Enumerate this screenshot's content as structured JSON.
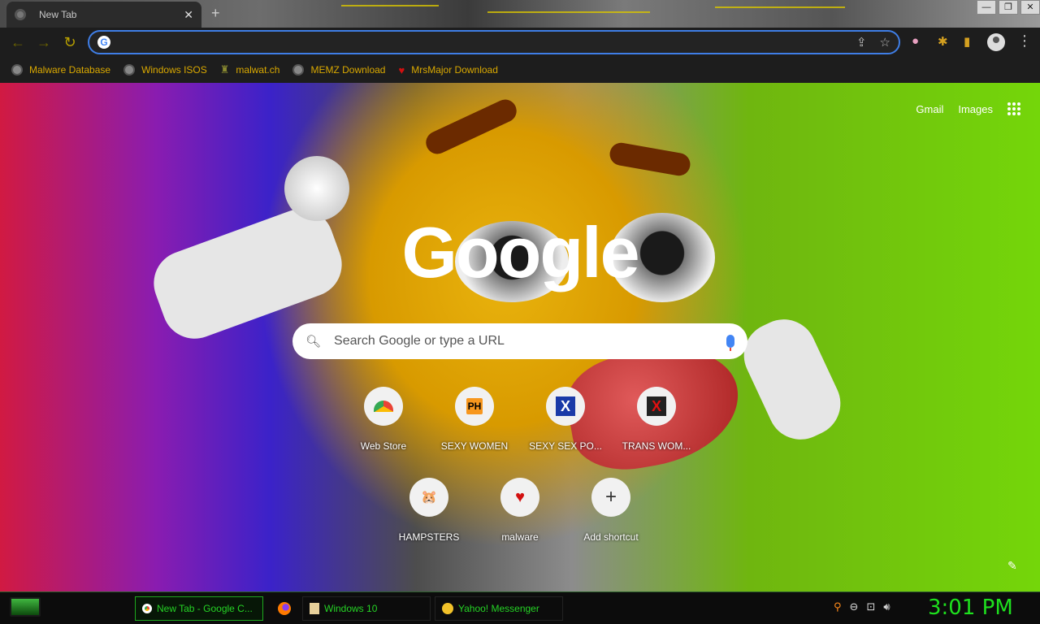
{
  "browser": {
    "tab": {
      "title": "New Tab",
      "close": "✕"
    },
    "new_tab": "+",
    "window_controls": {
      "minimize": "—",
      "restore": "❐",
      "close": "✕"
    },
    "toolbar": {
      "back": "←",
      "forward": "→",
      "reload": "↻",
      "address_value": "",
      "share_icon": "⇪",
      "star_icon": "☆",
      "extensions_icon": "✱",
      "sidepanel_icon": "▮",
      "menu_icon": "⋮"
    },
    "bookmarks": [
      {
        "label": "Malware Database",
        "icon": "globe-icon"
      },
      {
        "label": "Windows ISOS",
        "icon": "globe-icon"
      },
      {
        "label": "malwat.ch",
        "icon": "tower-icon"
      },
      {
        "label": "MEMZ Download",
        "icon": "globe-icon"
      },
      {
        "label": "MrsMajor Download",
        "icon": "heart-icon"
      }
    ]
  },
  "ntp": {
    "links": {
      "gmail": "Gmail",
      "images": "Images"
    },
    "logo": "Google",
    "search_placeholder": "Search Google or type a URL",
    "shortcuts": [
      {
        "name": "Web Store"
      },
      {
        "name": "SEXY WOMEN",
        "glyph": "PH"
      },
      {
        "name": "SEXY SEX PO...",
        "glyph": "X"
      },
      {
        "name": "TRANS WOM...",
        "glyph": "X"
      },
      {
        "name": "HAMPSTERS",
        "glyph": "🐹"
      },
      {
        "name": "malware",
        "glyph": "♥"
      },
      {
        "name": "Add shortcut",
        "glyph": "+"
      }
    ],
    "customize_icon": "✎"
  },
  "taskbar": {
    "items": [
      {
        "label": "New Tab - Google C...",
        "active": true
      },
      {
        "label": ""
      },
      {
        "label": "Windows 10"
      },
      {
        "label": "Yahoo! Messenger"
      }
    ],
    "clock": "3:01 PM"
  },
  "colors": {
    "accent_focus": "#3f7ee6",
    "bookmark_text": "#d9a800",
    "taskbar_text": "#25d325"
  }
}
